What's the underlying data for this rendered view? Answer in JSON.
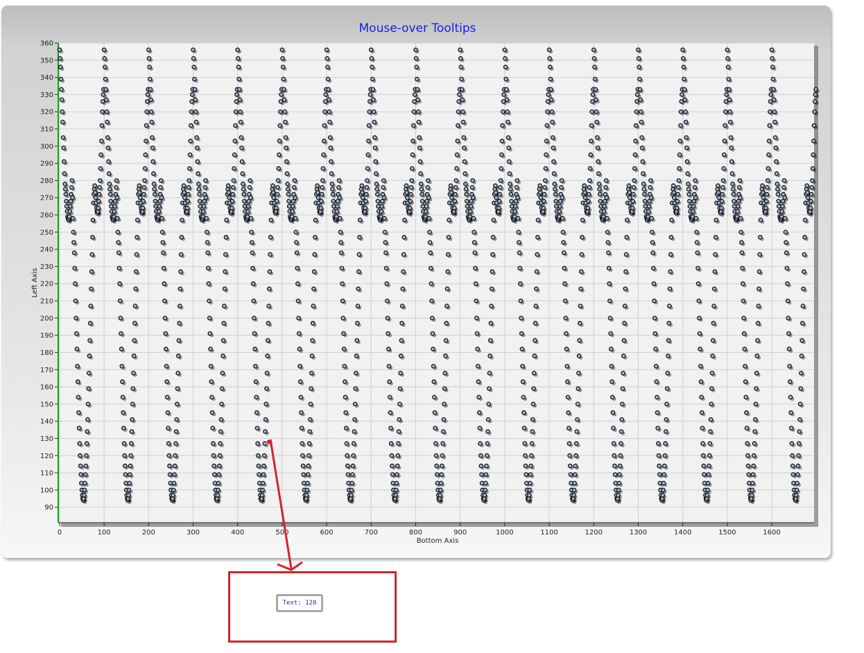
{
  "chart_data": {
    "type": "scatter",
    "title": "Mouse-over Tooltips",
    "xlabel": "Bottom Axis",
    "ylabel": "Left Axis",
    "xlim": [
      -3,
      1695
    ],
    "ylim": [
      81,
      360
    ],
    "xticks": [
      0,
      100,
      200,
      300,
      400,
      500,
      600,
      700,
      800,
      900,
      1000,
      1100,
      1200,
      1300,
      1400,
      1500,
      1600
    ],
    "yticks": [
      90,
      100,
      110,
      120,
      130,
      140,
      150,
      160,
      170,
      180,
      190,
      200,
      210,
      220,
      230,
      240,
      250,
      260,
      270,
      280,
      290,
      300,
      310,
      320,
      330,
      340,
      350,
      360
    ],
    "grid": true,
    "pattern_period": 100,
    "points_per_period": 100,
    "cycles": 17,
    "point_count": 1700,
    "pattern_y": [
      356,
      351,
      346,
      339,
      333,
      327,
      320,
      314,
      305,
      299,
      291,
      284,
      278,
      275,
      272,
      268,
      265,
      262,
      259,
      258,
      257,
      258,
      259,
      262,
      265,
      268,
      272,
      276,
      280,
      270,
      258,
      250,
      244,
      238,
      229,
      220,
      210,
      200,
      191,
      182,
      172,
      163,
      154,
      145,
      136,
      127,
      120,
      114,
      109,
      104,
      100,
      97,
      95,
      94,
      95,
      97,
      100,
      104,
      109,
      114,
      120,
      127,
      134,
      141,
      150,
      159,
      168,
      178,
      187,
      197,
      207,
      217,
      227,
      237,
      247,
      257,
      267,
      272,
      275,
      277,
      273,
      270,
      267,
      264,
      262,
      261,
      262,
      264,
      268,
      272,
      276,
      280,
      287,
      295,
      303,
      312,
      320,
      326,
      330,
      333
    ],
    "highlighted_point": {
      "x": 470,
      "y": 128
    },
    "highlight_color": "#e02020",
    "marker_fill": "#9fb4d4",
    "marker_stroke": "#141414",
    "y_axis_color": "#1a9a1a"
  },
  "tooltip": {
    "text": "Text: 128"
  },
  "colors": {
    "annotation": "#d2232a",
    "title": "#1a1aee"
  }
}
